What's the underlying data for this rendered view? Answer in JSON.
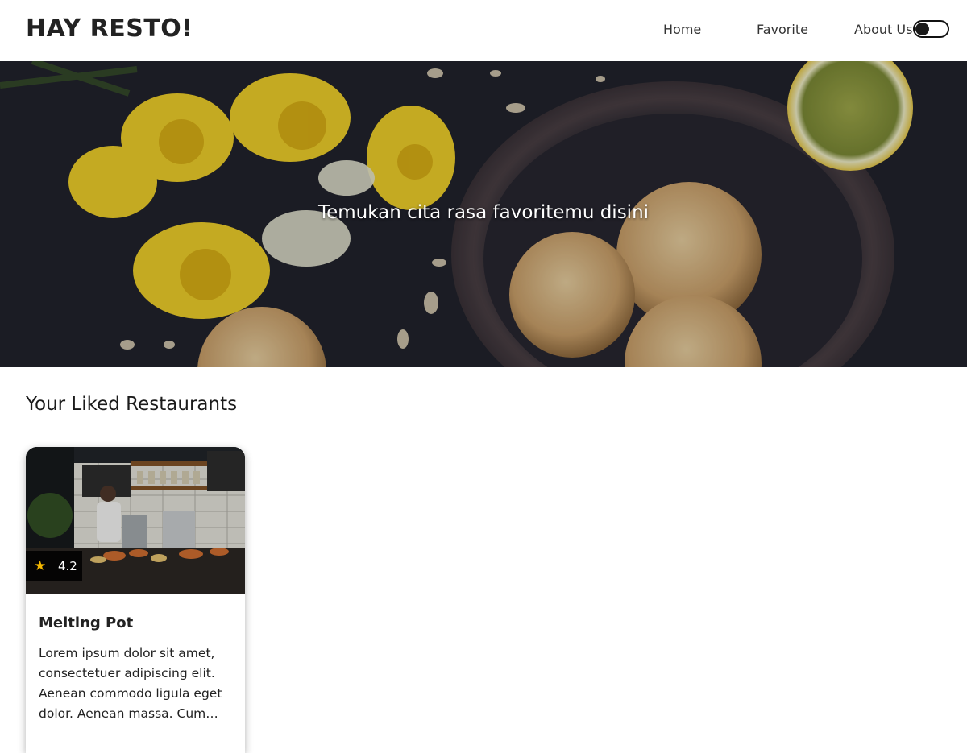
{
  "header": {
    "brand": "HAY RESTO!",
    "nav": [
      {
        "label": "Home"
      },
      {
        "label": "Favorite"
      },
      {
        "label": "About Us"
      }
    ]
  },
  "hero": {
    "tagline": "Temukan cita rasa favoritemu disini"
  },
  "main": {
    "section_title": "Your Liked Restaurants",
    "restaurants": [
      {
        "name": "Melting Pot",
        "rating": "4.2",
        "rating_icon": "star-icon",
        "description": "Lorem ipsum dolor sit amet, consectetuer adipiscing elit. Aenean commodo ligula eget dolor. Aenean massa. Cum sociis natoque penatibus et magnis dis parturient montes, nascetur ridiculus mus."
      }
    ]
  },
  "colors": {
    "star": "#f5b800",
    "text": "#222222",
    "badge_bg": "#000000"
  }
}
